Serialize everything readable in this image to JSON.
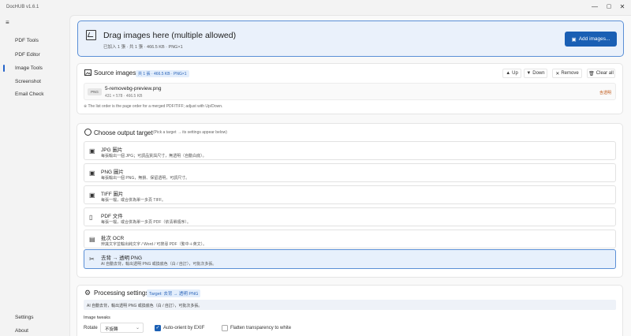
{
  "app": {
    "title": "DocHUB v1.6.1"
  },
  "window": {
    "minimize": "—",
    "maximize": "▢",
    "close": "✕"
  },
  "sidebar": {
    "items": [
      {
        "label": "PDF Tools"
      },
      {
        "label": "PDF Editor"
      },
      {
        "label": "Image Tools",
        "active": true
      },
      {
        "label": "Screenshot"
      },
      {
        "label": "Email Check"
      }
    ],
    "settings": "Settings",
    "about": "About"
  },
  "drop": {
    "title": "Drag images here (multiple allowed)",
    "subtitle": "已加入 1 張 · 共 1 張 · 466.5 KB · PNG×1",
    "add_button": "Add images..."
  },
  "source": {
    "title": "Source images",
    "tag": "共 1 張 · 466.5 KB · PNG×1",
    "buttons": {
      "up": "Up",
      "down": "Down",
      "remove": "Remove",
      "clear": "Clear all"
    },
    "file": {
      "badge": "PNG",
      "name": "5-removebg-preview.png",
      "meta": "431 × 578 · 466.5 KB",
      "status": "含透明"
    },
    "note": "※ The list order is the page order for a merged PDF/TIFF; adjust with Up/Down."
  },
  "output": {
    "title": "Choose output target",
    "hint": "(Pick a target → its settings appear below)",
    "targets": [
      {
        "icon": "image-icon",
        "name": "JPG 圖片",
        "desc": "每張輸出一個 JPG；可調品質與尺寸，無透明（自動白底）。"
      },
      {
        "icon": "image-icon",
        "name": "PNG 圖片",
        "desc": "每張輸出一個 PNG，無損、保留透明，可調尺寸。"
      },
      {
        "icon": "image-icon",
        "name": "TIFF 圖片",
        "desc": "每張一檔，或合併為單一多頁 TIFF。"
      },
      {
        "icon": "document-icon",
        "name": "PDF 文件",
        "desc": "每張一檔，或合併為單一多頁 PDF（依清單順序）。"
      },
      {
        "icon": "ocr-icon",
        "name": "批次 OCR",
        "desc": "辨識文字並輸出純文字 / Word / 可搜尋 PDF（繁中＋英文）。"
      },
      {
        "icon": "scissors-icon",
        "name": "去背 → 透明 PNG",
        "desc": "AI 自動去背，輸出透明 PNG 或換底色（白 / 自訂），可批次多張。",
        "selected": true
      }
    ]
  },
  "processing": {
    "title": "Processing settings",
    "target_tag": "Target: 去背 → 透明 PNG",
    "description": "AI 自動去背，輸出透明 PNG 或換底色（白 / 自訂），可批次多張。",
    "section": "Image tweaks",
    "rotate_label": "Rotate",
    "rotate_value": "不旋轉",
    "auto_orient": {
      "label": "Auto-orient by EXIF",
      "checked": true
    },
    "flatten": {
      "label": "Flatten transparency to white",
      "checked": false
    }
  },
  "colors": {
    "accent": "#1a5fb4",
    "selected_bg": "#e7f0fc",
    "tag_bg": "#e3eefc"
  }
}
